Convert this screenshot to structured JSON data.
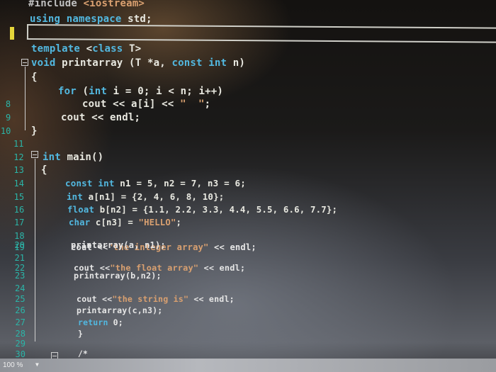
{
  "editor": {
    "language": "C++",
    "lines": [
      {
        "num": "",
        "text": "#include <iostream>"
      },
      {
        "num": "",
        "text": "using namespace std;"
      },
      {
        "num": "",
        "text": ""
      },
      {
        "num": "",
        "text": "template <class T>"
      },
      {
        "num": "",
        "text": "void printarray (T *a, const int n)"
      },
      {
        "num": "",
        "text": "{"
      },
      {
        "num": "",
        "text": "    for (int i = 0; i < n; i++)"
      },
      {
        "num": "8",
        "text": "        cout << a[i] << \"  \";"
      },
      {
        "num": "9",
        "text": "    cout << endl;"
      },
      {
        "num": "10",
        "text": "}"
      },
      {
        "num": "11",
        "text": ""
      },
      {
        "num": "12",
        "text": "int main()"
      },
      {
        "num": "13",
        "text": "{"
      },
      {
        "num": "14",
        "text": "const int n1 = 5, n2 = 7, n3 = 6;"
      },
      {
        "num": "15",
        "text": "int a[n1] = {2, 4, 6, 8, 10};"
      },
      {
        "num": "16",
        "text": "float b[n2] = {1.1, 2.2, 3.3, 4.4, 5.5, 6.6, 7.7};"
      },
      {
        "num": "17",
        "text": "char c[n3] = \"HELLO\";"
      },
      {
        "num": "18",
        "text": ""
      },
      {
        "num": "19",
        "text": "cout <<\"the integer array\" << endl;"
      },
      {
        "num": "20",
        "text": "printarray(a, n1);"
      },
      {
        "num": "21",
        "text": ""
      },
      {
        "num": "22",
        "text": "cout <<\"the float array\" << endl;"
      },
      {
        "num": "23",
        "text": "printarray(b,n2);"
      },
      {
        "num": "24",
        "text": ""
      },
      {
        "num": "25",
        "text": "cout <<\"the string is\" << endl;"
      },
      {
        "num": "26",
        "text": "printarray(c,n3);"
      },
      {
        "num": "27",
        "text": "return 0;"
      },
      {
        "num": "28",
        "text": "}"
      },
      {
        "num": "29",
        "text": ""
      },
      {
        "num": "30",
        "text": "/*"
      }
    ]
  },
  "status_bar": {
    "zoom_level": "100 %",
    "zoom_dropdown_icon": "chevron-down-icon"
  }
}
